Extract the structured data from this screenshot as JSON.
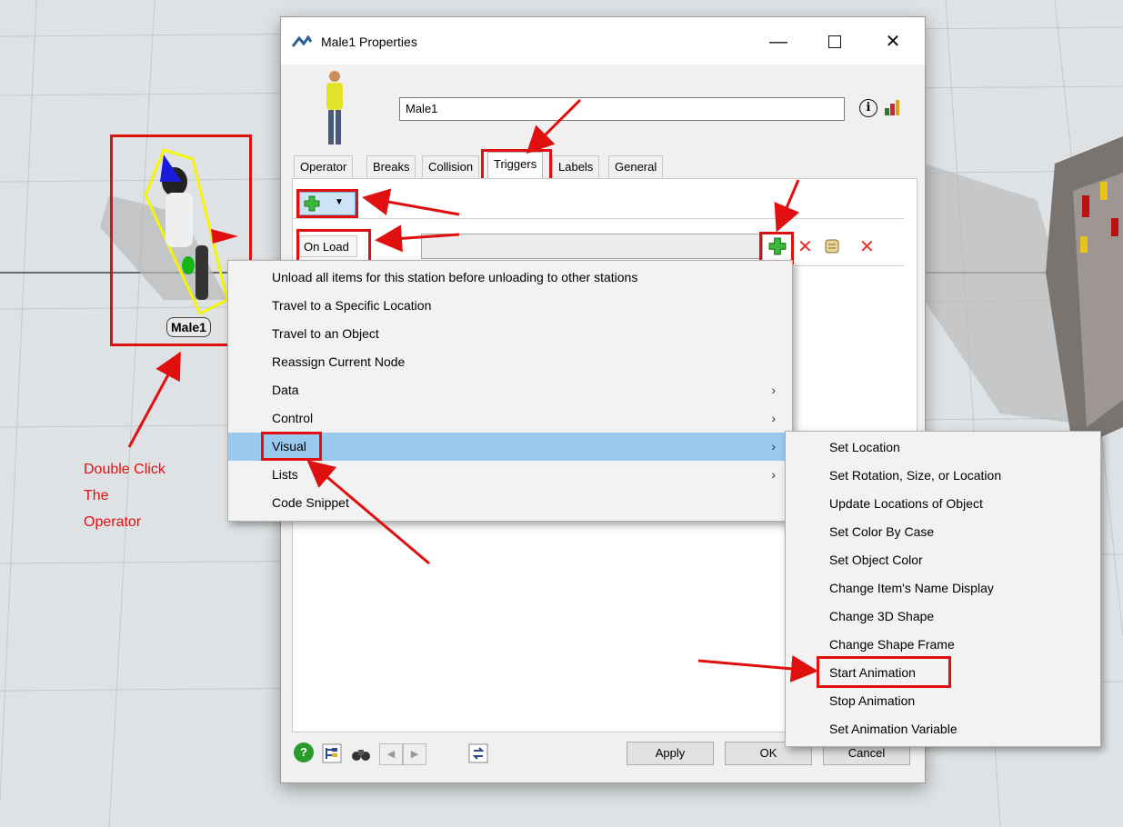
{
  "annotation": {
    "lines": [
      "Double Click",
      "The",
      "Operator"
    ]
  },
  "scene": {
    "operator_label": "Male1"
  },
  "dialog": {
    "title": "Male1  Properties",
    "name_value": "Male1",
    "tabs": [
      {
        "label": "Operator"
      },
      {
        "label": "Breaks"
      },
      {
        "label": "Collision"
      },
      {
        "label": "Triggers"
      },
      {
        "label": "Labels"
      },
      {
        "label": "General"
      }
    ],
    "active_tab": "Triggers",
    "trigger_label": "On Load",
    "buttons": {
      "apply": "Apply",
      "ok": "OK",
      "cancel": "Cancel"
    }
  },
  "context_menu": {
    "items": [
      {
        "label": "Unload all items for this station before unloading to other stations"
      },
      {
        "label": "Travel to a Specific Location"
      },
      {
        "label": "Travel to an Object"
      },
      {
        "label": "Reassign Current Node"
      },
      {
        "label": "Data"
      },
      {
        "label": "Control"
      },
      {
        "label": "Visual"
      },
      {
        "label": "Lists"
      },
      {
        "label": "Code Snippet"
      }
    ],
    "highlighted": "Visual"
  },
  "submenu": {
    "items": [
      {
        "label": "Set Location"
      },
      {
        "label": "Set Rotation, Size, or Location"
      },
      {
        "label": "Update Locations of Object"
      },
      {
        "label": "Set Color By Case"
      },
      {
        "label": "Set Object Color"
      },
      {
        "label": "Change Item's Name Display"
      },
      {
        "label": "Change 3D Shape"
      },
      {
        "label": "Change Shape Frame"
      },
      {
        "label": "Start Animation"
      },
      {
        "label": "Stop Animation"
      },
      {
        "label": "Set Animation Variable"
      }
    ],
    "highlighted": "Start Animation"
  },
  "colors": {
    "annotation_red": "#e01010",
    "menu_highlight": "#99c9ef",
    "operator_box": "#f5f500"
  },
  "icons": [
    "flexsim-app-icon",
    "minimize-icon",
    "maximize-icon",
    "close-icon",
    "info-icon",
    "chart-icon",
    "add-icon",
    "dropdown-arrow-icon",
    "delete-icon",
    "script-icon",
    "help-icon",
    "tree-icon",
    "binoculars-icon",
    "left-arrow-icon",
    "right-arrow-icon",
    "refresh-icon"
  ]
}
